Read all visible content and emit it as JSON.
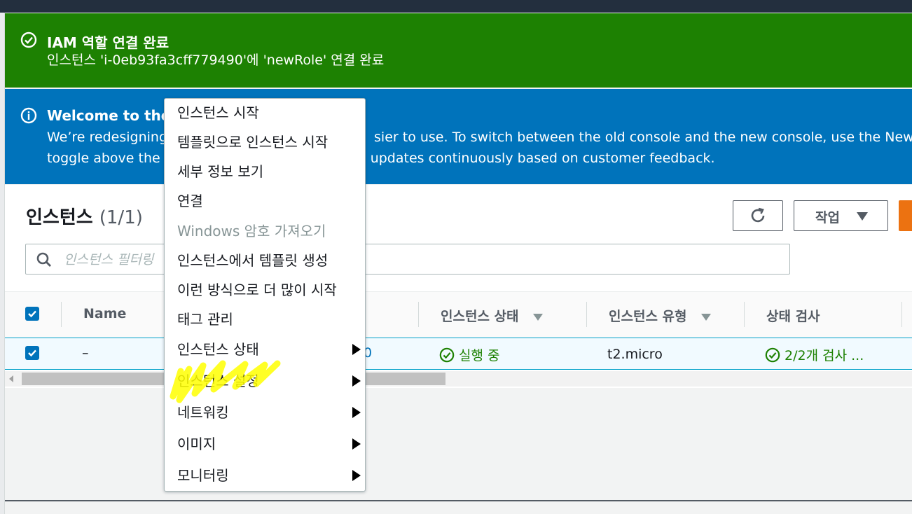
{
  "success_flash": {
    "title": "IAM 역할 연결 완료",
    "message": "인스턴스 'i-0eb93fa3cff779490'에 'newRole' 연결 완료",
    "icon": "check-circle-icon"
  },
  "info_flash": {
    "title": "Welcome to the r",
    "line1_a": "We’re redesigning",
    "line1_b": "sier to use. To switch between the old console and the new console, use the New E",
    "line2_a": "toggle above the",
    "line2_b": "updates continuously based on customer feedback.",
    "icon": "info-circle-icon"
  },
  "instances_panel": {
    "title": "인스턴스",
    "count": "(1/1)",
    "refresh_icon": "refresh-icon",
    "actions_label": "작업",
    "search_placeholder": "인스턴스 필터링"
  },
  "table": {
    "columns": {
      "name": "Name",
      "state": "인스턴스 상태",
      "type": "인스턴스 유형",
      "status_check": "상태 검사"
    },
    "row": {
      "name": "–",
      "id_fragment": "0",
      "state": "실행 중",
      "type": "t2.micro",
      "status_check": "2/2개 검사 ..."
    }
  },
  "context_menu": {
    "items": [
      {
        "label": "인스턴스 시작",
        "submenu": false,
        "disabled": false
      },
      {
        "label": "템플릿으로 인스턴스 시작",
        "submenu": false,
        "disabled": false
      },
      {
        "label": "세부 정보 보기",
        "submenu": false,
        "disabled": false
      },
      {
        "label": "연결",
        "submenu": false,
        "disabled": false
      },
      {
        "label": "Windows 암호 가져오기",
        "submenu": false,
        "disabled": true
      },
      {
        "label": "인스턴스에서 템플릿 생성",
        "submenu": false,
        "disabled": false
      },
      {
        "label": "이런 방식으로 더 많이 시작",
        "submenu": false,
        "disabled": false
      },
      {
        "label": "태그 관리",
        "submenu": false,
        "disabled": false
      },
      {
        "label": "인스턴스 상태",
        "submenu": true,
        "disabled": false
      },
      {
        "label": "인스턴스 설정",
        "submenu": true,
        "disabled": false
      },
      {
        "label": "네트워킹",
        "submenu": true,
        "disabled": false
      },
      {
        "label": "이미지",
        "submenu": true,
        "disabled": false
      },
      {
        "label": "모니터링",
        "submenu": true,
        "disabled": false
      }
    ]
  },
  "colors": {
    "success": "#1d8102",
    "info": "#0073bb",
    "highlight": "#ffff00",
    "accent": "#ec7211"
  }
}
